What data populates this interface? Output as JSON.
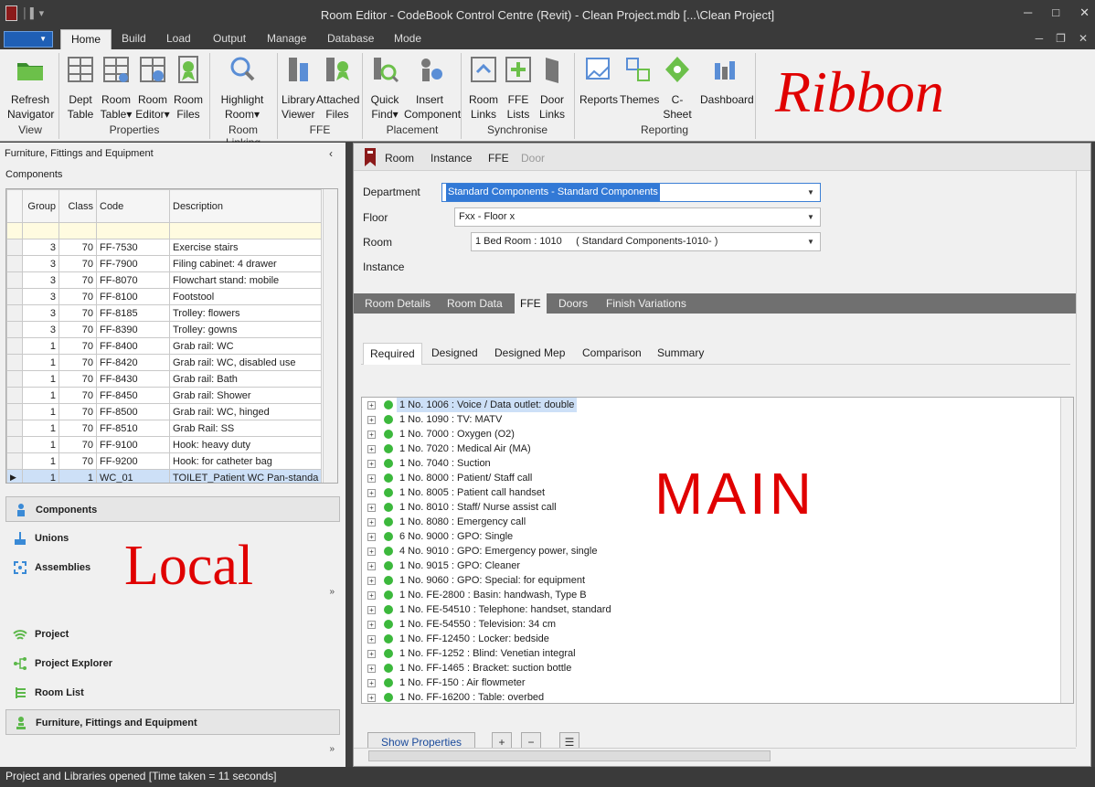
{
  "window": {
    "title": "Room Editor - CodeBook Control Centre  (Revit)  - Clean Project.mdb    [...\\Clean Project]"
  },
  "ribbon": {
    "tabs": [
      "Home",
      "Build",
      "Load",
      "Output",
      "Manage",
      "Database",
      "Mode"
    ],
    "active_tab": "Home",
    "buttons": {
      "refresh": [
        "Refresh",
        "Navigator"
      ],
      "dept_table": [
        "Dept",
        "Table"
      ],
      "room_table": [
        "Room",
        "Table"
      ],
      "room_editor": [
        "Room",
        "Editor"
      ],
      "room_files": [
        "Room",
        "Files"
      ],
      "highlight_room": [
        "Highlight",
        "Room"
      ],
      "library_viewer": [
        "Library",
        "Viewer"
      ],
      "attached_files": [
        "Attached",
        "Files"
      ],
      "quick_find": [
        "Quick",
        "Find"
      ],
      "insert_component": [
        "Insert",
        "Component"
      ],
      "room_links": [
        "Room",
        "Links"
      ],
      "ffe_lists": [
        "FFE",
        "Lists"
      ],
      "door_links": [
        "Door",
        "Links"
      ],
      "reports": "Reports",
      "themes": "Themes",
      "csheet": "C-Sheet",
      "dashboard": "Dashboard"
    },
    "groups": [
      "View",
      "Properties",
      "Room Linking",
      "FFE",
      "Placement",
      "Synchronise",
      "Reporting"
    ],
    "annotation": "Ribbon"
  },
  "left_panel": {
    "title": "Furniture, Fittings and Equipment",
    "subtitle": "Components",
    "columns": [
      "Group",
      "Class",
      "Code",
      "Description"
    ],
    "rows": [
      [
        "3",
        "70",
        "FF-7530",
        "Exercise stairs"
      ],
      [
        "3",
        "70",
        "FF-7900",
        "Filing cabinet: 4 drawer"
      ],
      [
        "3",
        "70",
        "FF-8070",
        "Flowchart stand: mobile"
      ],
      [
        "3",
        "70",
        "FF-8100",
        "Footstool"
      ],
      [
        "3",
        "70",
        "FF-8185",
        "Trolley: flowers"
      ],
      [
        "3",
        "70",
        "FF-8390",
        "Trolley: gowns"
      ],
      [
        "1",
        "70",
        "FF-8400",
        "Grab rail: WC"
      ],
      [
        "1",
        "70",
        "FF-8420",
        "Grab rail: WC, disabled use"
      ],
      [
        "1",
        "70",
        "FF-8430",
        "Grab rail: Bath"
      ],
      [
        "1",
        "70",
        "FF-8450",
        "Grab rail: Shower"
      ],
      [
        "1",
        "70",
        "FF-8500",
        "Grab rail: WC, hinged"
      ],
      [
        "1",
        "70",
        "FF-8510",
        "Grab Rail: SS"
      ],
      [
        "1",
        "70",
        "FF-9100",
        "Hook: heavy duty"
      ],
      [
        "1",
        "70",
        "FF-9200",
        "Hook: for catheter bag"
      ],
      [
        "1",
        "1",
        "WC_01",
        "TOILET_Patient WC Pan-standa"
      ]
    ],
    "nav_top": [
      "Components",
      "Unions",
      "Assemblies"
    ],
    "nav_bottom": [
      "Project",
      "Project Explorer",
      "Room List",
      "Furniture, Fittings and Equipment"
    ],
    "annotation": "Local"
  },
  "main_panel": {
    "top_tabs": [
      "Room",
      "Instance",
      "FFE",
      "Door"
    ],
    "labels": {
      "department": "Department",
      "floor": "Floor",
      "room": "Room",
      "instance": "Instance"
    },
    "department_value": "Standard Components - Standard Components",
    "floor_value": "Fxx - Floor x",
    "room_value": "1 Bed Room : 1010     ( Standard Components-1010- )",
    "tabs1": [
      "Room Details",
      "Room Data",
      "FFE",
      "Doors",
      "Finish Variations"
    ],
    "tabs2": [
      "Required",
      "Designed",
      "Designed Mep",
      "Comparison",
      "Summary"
    ],
    "items": [
      "1 No. 1006 : Voice / Data outlet: double",
      "1 No. 1090 : TV: MATV",
      "1 No. 7000 : Oxygen (O2)",
      "1 No. 7020 : Medical Air (MA)",
      "1 No. 7040 : Suction",
      "1 No. 8000 : Patient/ Staff call",
      "1 No. 8005 : Patient call handset",
      "1 No. 8010 : Staff/ Nurse assist call",
      "1 No. 8080 : Emergency call",
      "6 No. 9000 : GPO: Single",
      "4 No. 9010 : GPO: Emergency power, single",
      "1 No. 9015 : GPO: Cleaner",
      "1 No. 9060 : GPO: Special: for equipment",
      "1 No. FE-2800 : Basin: handwash, Type B",
      "1 No. FE-54510 : Telephone: handset, standard",
      "1 No. FE-54550 : Television: 34 cm",
      "1 No. FF-12450 : Locker: bedside",
      "1 No. FF-1252 : Blind: Venetian integral",
      "1 No. FF-1465 : Bracket: suction bottle",
      "1 No. FF-150 : Air flowmeter",
      "1 No. FF-16200 : Table: overbed"
    ],
    "show_properties": "Show Properties",
    "plus": "+",
    "minus": "−",
    "annotation": "MAIN"
  },
  "status": "Project and Libraries opened  [Time taken = 11 seconds]"
}
